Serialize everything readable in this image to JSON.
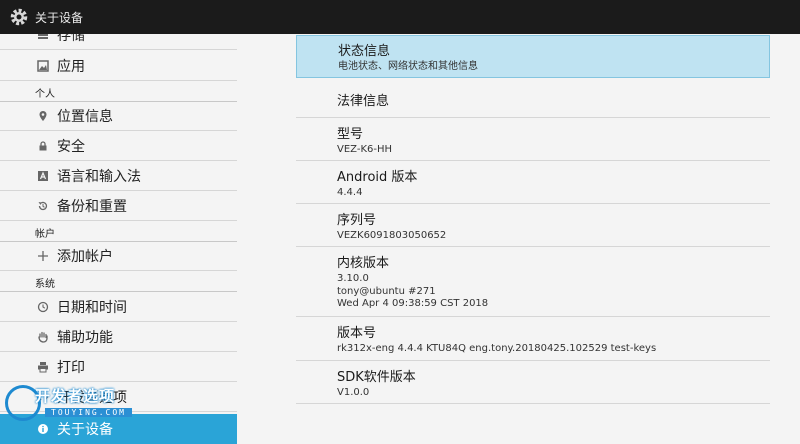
{
  "action_bar": {
    "title": "关于设备",
    "icon": "gear-icon"
  },
  "sidebar": {
    "items": [
      {
        "label": "存储",
        "icon": "storage-icon"
      },
      {
        "label": "应用",
        "icon": "apps-icon"
      },
      {
        "header": "个人"
      },
      {
        "label": "位置信息",
        "icon": "location-pin-icon"
      },
      {
        "label": "安全",
        "icon": "lock-icon"
      },
      {
        "label": "语言和输入法",
        "icon": "language-icon"
      },
      {
        "label": "备份和重置",
        "icon": "backup-restore-icon"
      },
      {
        "header": "帐户"
      },
      {
        "label": "添加帐户",
        "icon": "plus-icon"
      },
      {
        "header": "系统"
      },
      {
        "label": "日期和时间",
        "icon": "clock-icon"
      },
      {
        "label": "辅助功能",
        "icon": "hand-icon"
      },
      {
        "label": "打印",
        "icon": "printer-icon"
      },
      {
        "label": "开发者选项",
        "icon": "code-icon"
      },
      {
        "label": "关于设备",
        "icon": "info-icon",
        "selected": true
      }
    ]
  },
  "content": {
    "rows": [
      {
        "title": "状态信息",
        "summary": [
          "电池状态、网络状态和其他信息"
        ],
        "selected": true
      },
      {
        "title": "法律信息",
        "summary": []
      },
      {
        "title": "型号",
        "summary": [
          "VEZ-K6-HH"
        ]
      },
      {
        "title": "Android 版本",
        "summary": [
          "4.4.4"
        ]
      },
      {
        "title": "序列号",
        "summary": [
          "VEZK6091803050652"
        ]
      },
      {
        "title": "内核版本",
        "summary": [
          "3.10.0",
          "tony@ubuntu #271",
          "Wed Apr 4 09:38:59 CST 2018"
        ]
      },
      {
        "title": "版本号",
        "summary": [
          "rk312x-eng 4.4.4 KTU84Q eng.tony.20180425.102529 test-keys"
        ]
      },
      {
        "title": "SDK软件版本",
        "summary": [
          "V1.0.0"
        ]
      }
    ]
  },
  "watermark": {
    "text": "开发者选项",
    "sub": "TOUYING.COM"
  },
  "colors": {
    "action_bar": "#1b1b1b",
    "selected_sidebar": "#2aa4d7",
    "selected_row": "#bfe3f2"
  }
}
